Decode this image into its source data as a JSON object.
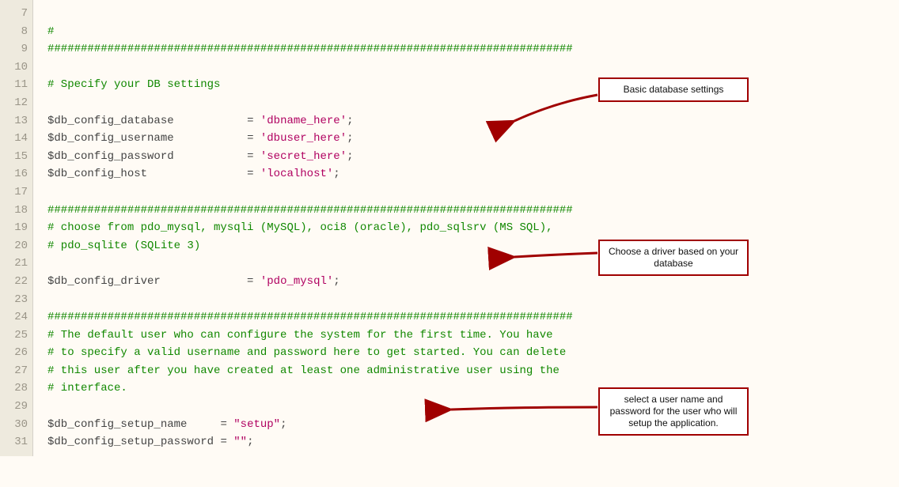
{
  "gutter": {
    "start": 7,
    "end": 31
  },
  "lines": {
    "l7": {
      "comment": "#"
    },
    "l8": {
      "comment": "###############################################################################"
    },
    "l9": {
      "blank": ""
    },
    "l10": {
      "comment": "# Specify your DB settings"
    },
    "l11": {
      "blank": ""
    },
    "l12": {
      "var": "$db_config_database",
      "pad": "           ",
      "op": "= ",
      "str": "'dbname_here'",
      "semi": ";"
    },
    "l13": {
      "var": "$db_config_username",
      "pad": "           ",
      "op": "= ",
      "str": "'dbuser_here'",
      "semi": ";"
    },
    "l14": {
      "var": "$db_config_password",
      "pad": "           ",
      "op": "= ",
      "str": "'secret_here'",
      "semi": ";"
    },
    "l15": {
      "var": "$db_config_host",
      "pad": "               ",
      "op": "= ",
      "str": "'localhost'",
      "semi": ";"
    },
    "l16": {
      "blank": ""
    },
    "l17": {
      "comment": "###############################################################################"
    },
    "l18": {
      "comment": "# choose from pdo_mysql, mysqli (MySQL), oci8 (oracle), pdo_sqlsrv (MS SQL),"
    },
    "l19": {
      "comment": "# pdo_sqlite (SQLite 3)"
    },
    "l20": {
      "blank": ""
    },
    "l21": {
      "var": "$db_config_driver",
      "pad": "             ",
      "op": "= ",
      "str": "'pdo_mysql'",
      "semi": ";"
    },
    "l22": {
      "blank": ""
    },
    "l23": {
      "comment": "###############################################################################"
    },
    "l24": {
      "comment": "# The default user who can configure the system for the first time. You have"
    },
    "l25": {
      "comment": "# to specify a valid username and password here to get started. You can delete"
    },
    "l26": {
      "comment": "# this user after you have created at least one administrative user using the"
    },
    "l27": {
      "comment": "# interface."
    },
    "l28": {
      "blank": ""
    },
    "l29": {
      "var": "$db_config_setup_name",
      "pad": "     ",
      "op": "= ",
      "str": "\"setup\"",
      "semi": ";"
    },
    "l30": {
      "var": "$db_config_setup_password",
      "pad": " ",
      "op": "= ",
      "str": "\"\"",
      "semi": ";"
    },
    "l31": {
      "blank": ""
    }
  },
  "callouts": {
    "db": {
      "text": "Basic database settings"
    },
    "driver": {
      "text": "Choose a driver based on your database"
    },
    "setup": {
      "text": "select a user name and password for the user who will setup the application."
    }
  }
}
